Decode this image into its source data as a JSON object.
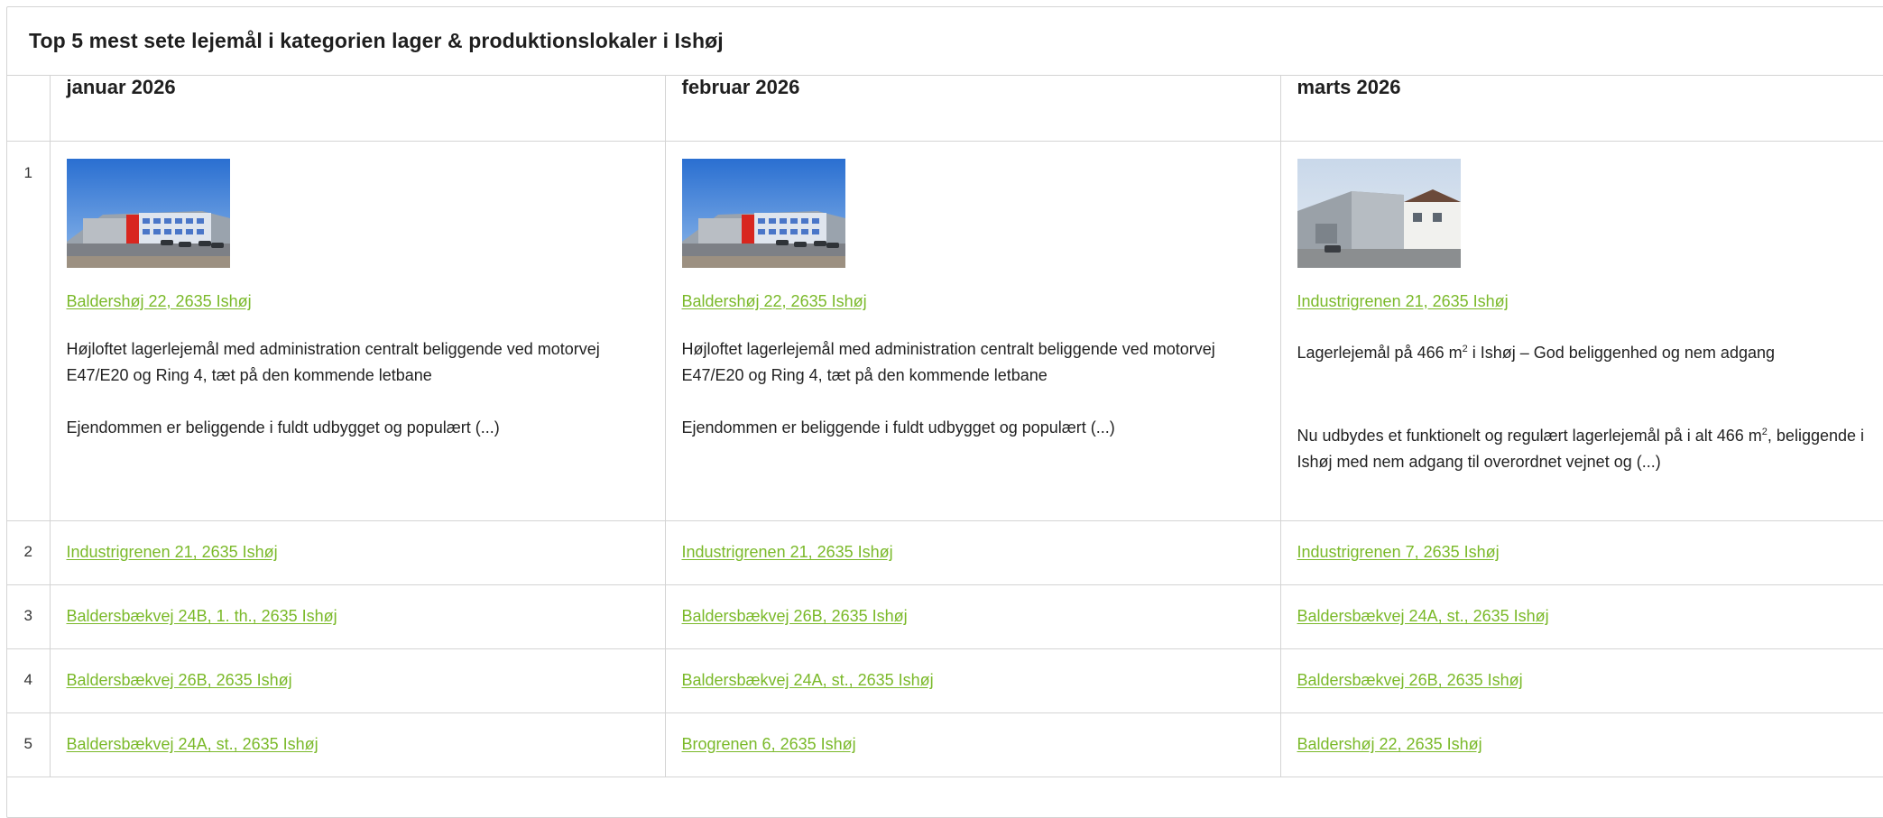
{
  "title": "Top 5 mest sete lejemål i kategorien lager & produktionslokaler i Ishøj",
  "months": [
    "januar 2026",
    "februar 2026",
    "marts 2026"
  ],
  "ranks": [
    "1",
    "2",
    "3",
    "4",
    "5"
  ],
  "link_color": "#7ab929",
  "top": [
    {
      "image": "warehouse-photo-baldershoj",
      "address": "Baldershøj 22, 2635 Ishøj",
      "desc1": "Højloftet lagerlejemål med administration centralt beliggende ved motorvej E47/E20 og Ring 4, tæt på den kommende letbane",
      "desc2": "Ejendommen er beliggende i fuldt udbygget og populært (...)"
    },
    {
      "image": "warehouse-photo-baldershoj",
      "address": "Baldershøj 22, 2635 Ishøj",
      "desc1": "Højloftet lagerlejemål med administration centralt beliggende ved motorvej E47/E20 og Ring 4, tæt på den kommende letbane",
      "desc2": "Ejendommen er beliggende i fuldt udbygget og populært (...)"
    },
    {
      "image": "warehouse-photo-industrigrenen",
      "address": "Industrigrenen 21, 2635 Ishøj",
      "desc1_pre": "Lagerlejemål på 466 m",
      "desc1_sup": "2",
      "desc1_post": " i Ishøj – God beliggenhed og nem adgang",
      "desc2_pre": "Nu udbydes et funktionelt og regulært lagerlejemål på i alt 466 m",
      "desc2_sup": "2",
      "desc2_post": ", beliggende i Ishøj med nem adgang til overordnet vejnet og (...)"
    }
  ],
  "rows": [
    [
      "Industrigrenen 21, 2635 Ishøj",
      "Industrigrenen 21, 2635 Ishøj",
      "Industrigrenen 7, 2635 Ishøj"
    ],
    [
      "Baldersbækvej 24B, 1. th., 2635 Ishøj",
      "Baldersbækvej 26B, 2635 Ishøj",
      "Baldersbækvej 24A, st., 2635 Ishøj"
    ],
    [
      "Baldersbækvej 26B, 2635 Ishøj",
      "Baldersbækvej 24A, st., 2635 Ishøj",
      "Baldersbækvej 26B, 2635 Ishøj"
    ],
    [
      "Baldersbækvej 24A, st., 2635 Ishøj",
      "Brogrenen 6, 2635 Ishøj",
      "Baldershøj 22, 2635 Ishøj"
    ]
  ]
}
